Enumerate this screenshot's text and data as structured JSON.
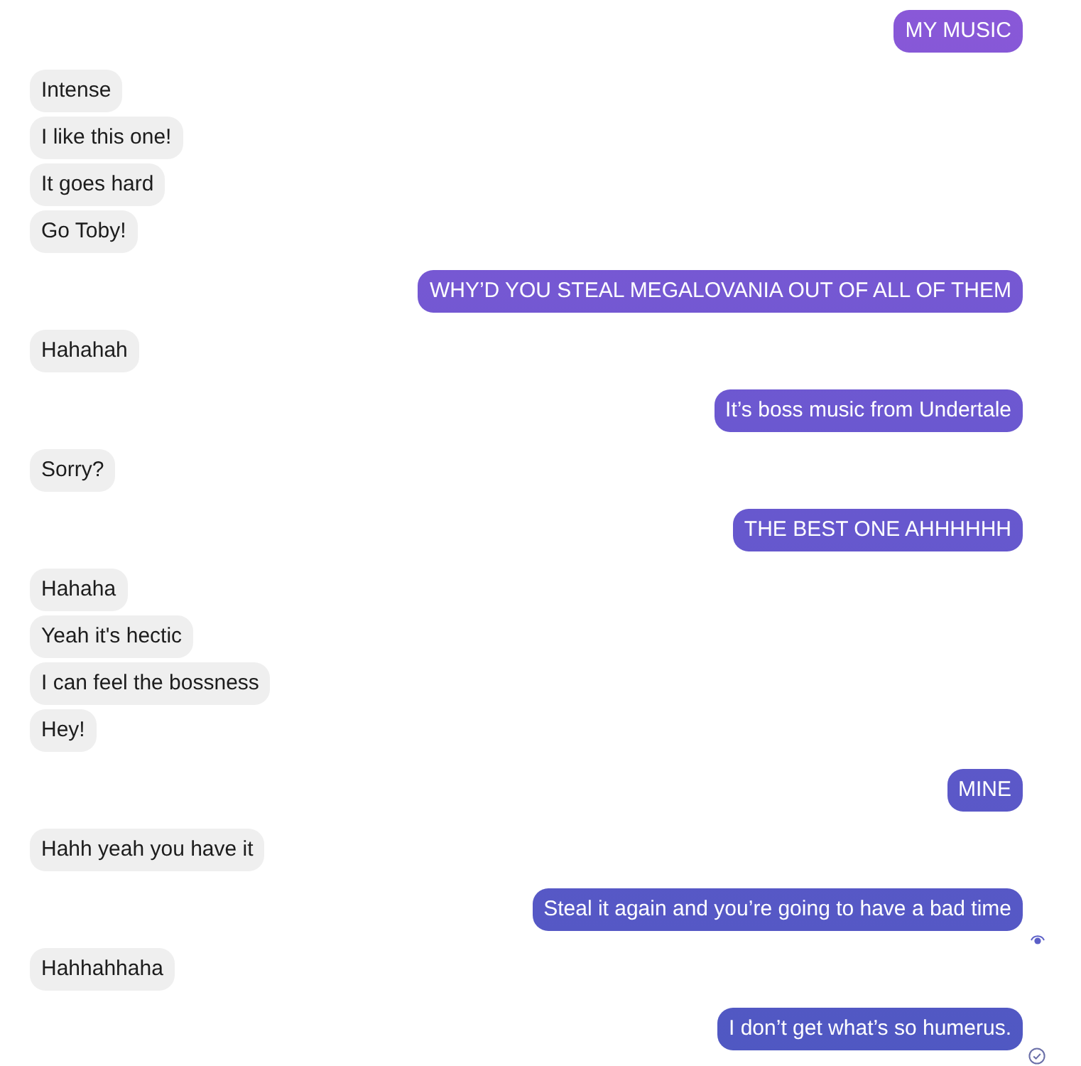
{
  "groups": [
    {
      "kind": "sent",
      "messages": [
        {
          "text": "MY MUSIC"
        }
      ]
    },
    {
      "kind": "received",
      "messages": [
        {
          "text": "Intense"
        },
        {
          "text": "I like this one!"
        },
        {
          "text": "It goes hard"
        },
        {
          "text": "Go Toby!"
        }
      ]
    },
    {
      "kind": "sent",
      "messages": [
        {
          "text": "WHY’D YOU STEAL MEGALOVANIA OUT OF ALL OF THEM"
        }
      ]
    },
    {
      "kind": "received",
      "messages": [
        {
          "text": "Hahahah"
        }
      ]
    },
    {
      "kind": "sent",
      "messages": [
        {
          "text": "It’s boss music from Undertale"
        }
      ]
    },
    {
      "kind": "received",
      "messages": [
        {
          "text": "Sorry?"
        }
      ]
    },
    {
      "kind": "sent",
      "messages": [
        {
          "text": "THE BEST ONE AHHHHHH"
        }
      ]
    },
    {
      "kind": "received",
      "messages": [
        {
          "text": "Hahaha"
        },
        {
          "text": "Yeah it's hectic"
        },
        {
          "text": "I can feel the bossness"
        },
        {
          "text": "Hey!"
        }
      ]
    },
    {
      "kind": "sent",
      "messages": [
        {
          "text": "MINE"
        }
      ]
    },
    {
      "kind": "received",
      "messages": [
        {
          "text": "Hahh yeah you have it"
        }
      ]
    },
    {
      "kind": "sent",
      "messages": [
        {
          "text": "Steal it again and you’re going to have a bad time",
          "seen": true
        }
      ]
    },
    {
      "kind": "received",
      "messages": [
        {
          "text": "Hahhahhaha"
        }
      ]
    },
    {
      "kind": "sent",
      "messages": [
        {
          "text": "I don’t get what’s so humerus.",
          "seen": false
        }
      ]
    }
  ]
}
